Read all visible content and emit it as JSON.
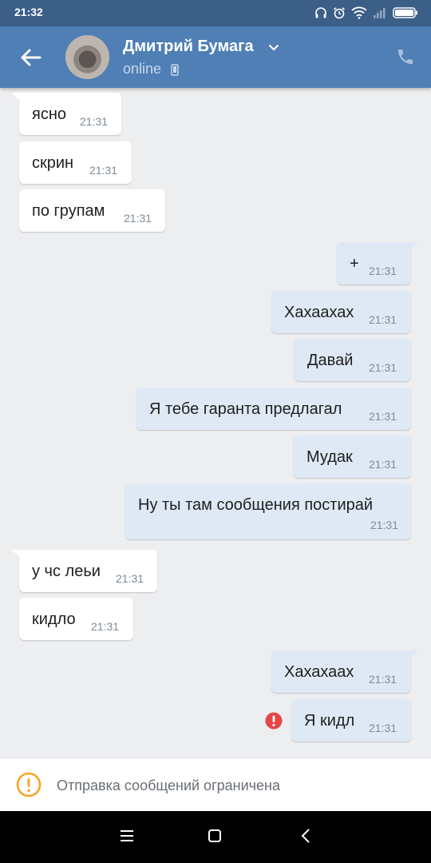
{
  "status_bar": {
    "time": "21:32"
  },
  "header": {
    "name": "Дмитрий Бумага",
    "status": "online"
  },
  "messages": [
    {
      "text": "ясно",
      "time": "21:31"
    },
    {
      "text": "скрин",
      "time": "21:31"
    },
    {
      "text": "по групам",
      "time": "21:31"
    },
    {
      "text": "+",
      "time": "21:31"
    },
    {
      "text": "Хахаахах",
      "time": "21:31"
    },
    {
      "text": "Давай",
      "time": "21:31"
    },
    {
      "text": "Я тебе гаранта предлагал",
      "time": "21:31"
    },
    {
      "text": "Мудак",
      "time": "21:31"
    },
    {
      "text": "Ну ты там сообщения постирай",
      "time": "21:31"
    },
    {
      "text": "у чс леьи",
      "time": "21:31"
    },
    {
      "text": "кидло",
      "time": "21:31"
    },
    {
      "text": "Хахахаах",
      "time": "21:31"
    },
    {
      "text": "Я кидл",
      "time": "21:31"
    }
  ],
  "restriction": {
    "label": "Отправка сообщений ограничена"
  },
  "colors": {
    "header": "#4f7fb5",
    "statusbar": "#3c5f88",
    "outgoing": "#dfe9f6",
    "incoming": "#ffffff",
    "error": "#e64646",
    "warning": "#f5a623"
  }
}
